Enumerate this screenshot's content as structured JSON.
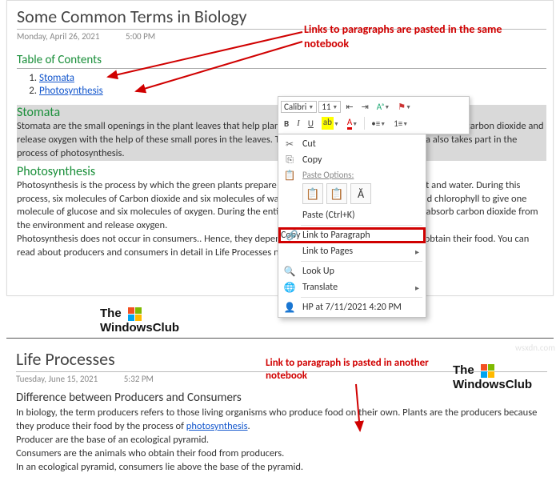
{
  "page1": {
    "title": "Some Common Terms in Biology",
    "date": "Monday, April 26, 2021",
    "time": "5:00 PM",
    "toc_head": "Table of Contents",
    "toc": [
      "Stomata",
      "Photosynthesis"
    ],
    "h_stomata": "Stomata",
    "stomata_body": "Stomata are the small openings in the plant leaves that help plants in the exchange of gases. The plants take in carbon dioxide and release oxygen with the help of these small pores in the leaves. The pores are called stomata. Stomata also takes part in the process of photosynthesis.",
    "h_photo": "Photosynthesis",
    "photo_body1": "Photosynthesis is the process by which the green plants prepare their food in the presence of sunlight and water. During this process, six molecules of Carbon dioxide and six molecules of water react in the presence of water and chlorophyll to give one molecule of glucose and six molecules of oxygen. During the entire process of photosynthesis, plants absorb carbon dioxide from the environment and release oxygen.",
    "photo_body2": "Photosynthesis does not occur in consumers.. Hence, they depend on consumers (and producers) to obtain their food. You can read about producers and consumers in detail in Life Processes notebook."
  },
  "page2": {
    "title": "Life Processes",
    "date": "Tuesday, June 15, 2021",
    "time": "5:32 PM",
    "sub": "Difference between Producers and Consumers",
    "b1": "In biology, the term producers refers to those living organisms who produce food on their own. Plants are the producers because they produce their food by the process of ",
    "link": "photosynthesis",
    "b2": ".",
    "b3": "Producer are the base of an ecological pyramid.",
    "b4": "Consumers are the animals who obtain their food from producers.",
    "b5": "In an ecological pyramid, consumers lie above the base of the pyramid."
  },
  "anno1": "Links to paragraphs are pasted in the same notebook",
  "anno2": "Link to paragraph is pasted in another notebook",
  "logo1": "The",
  "logo2": "WindowsClub",
  "watermark": "wsxdn.com",
  "toolbar": {
    "font": "Calibri",
    "size": "11"
  },
  "ctx": {
    "cut": "Cut",
    "copy": "Copy",
    "paste_label": "Paste Options:",
    "paste": "Paste (Ctrl+K)",
    "copylink": "Copy Link to Paragraph",
    "linkpages": "Link to Pages",
    "lookup": "Look Up",
    "translate": "Translate",
    "hp": "HP at 7/11/2021 4:20 PM"
  }
}
